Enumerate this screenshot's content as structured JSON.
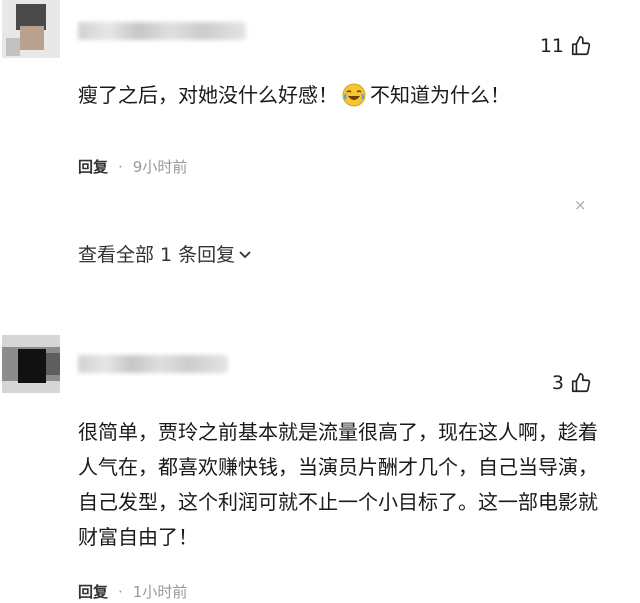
{
  "comments": [
    {
      "likes": "11",
      "text_parts": [
        "瘦了之后，对她没什么好感！",
        "不知道为什么！"
      ],
      "emoji": "crying-laughing-emoji",
      "reply_label": "回复",
      "separator": "·",
      "time": "9小时前",
      "view_replies_label": "查看全部 1 条回复",
      "close_label": "×"
    },
    {
      "likes": "3",
      "text": "很简单，贾玲之前基本就是流量很高了，现在这人啊，趁着人气在，都喜欢赚快钱，当演员片酬才几个，自己当导演，自己发型，这个利润可就不止一个小目标了。这一部电影就财富自由了！",
      "reply_label": "回复",
      "separator": "·",
      "time": "1小时前"
    }
  ],
  "icons": [
    "thumbs-up-icon",
    "close-icon",
    "chevron-down-icon"
  ]
}
